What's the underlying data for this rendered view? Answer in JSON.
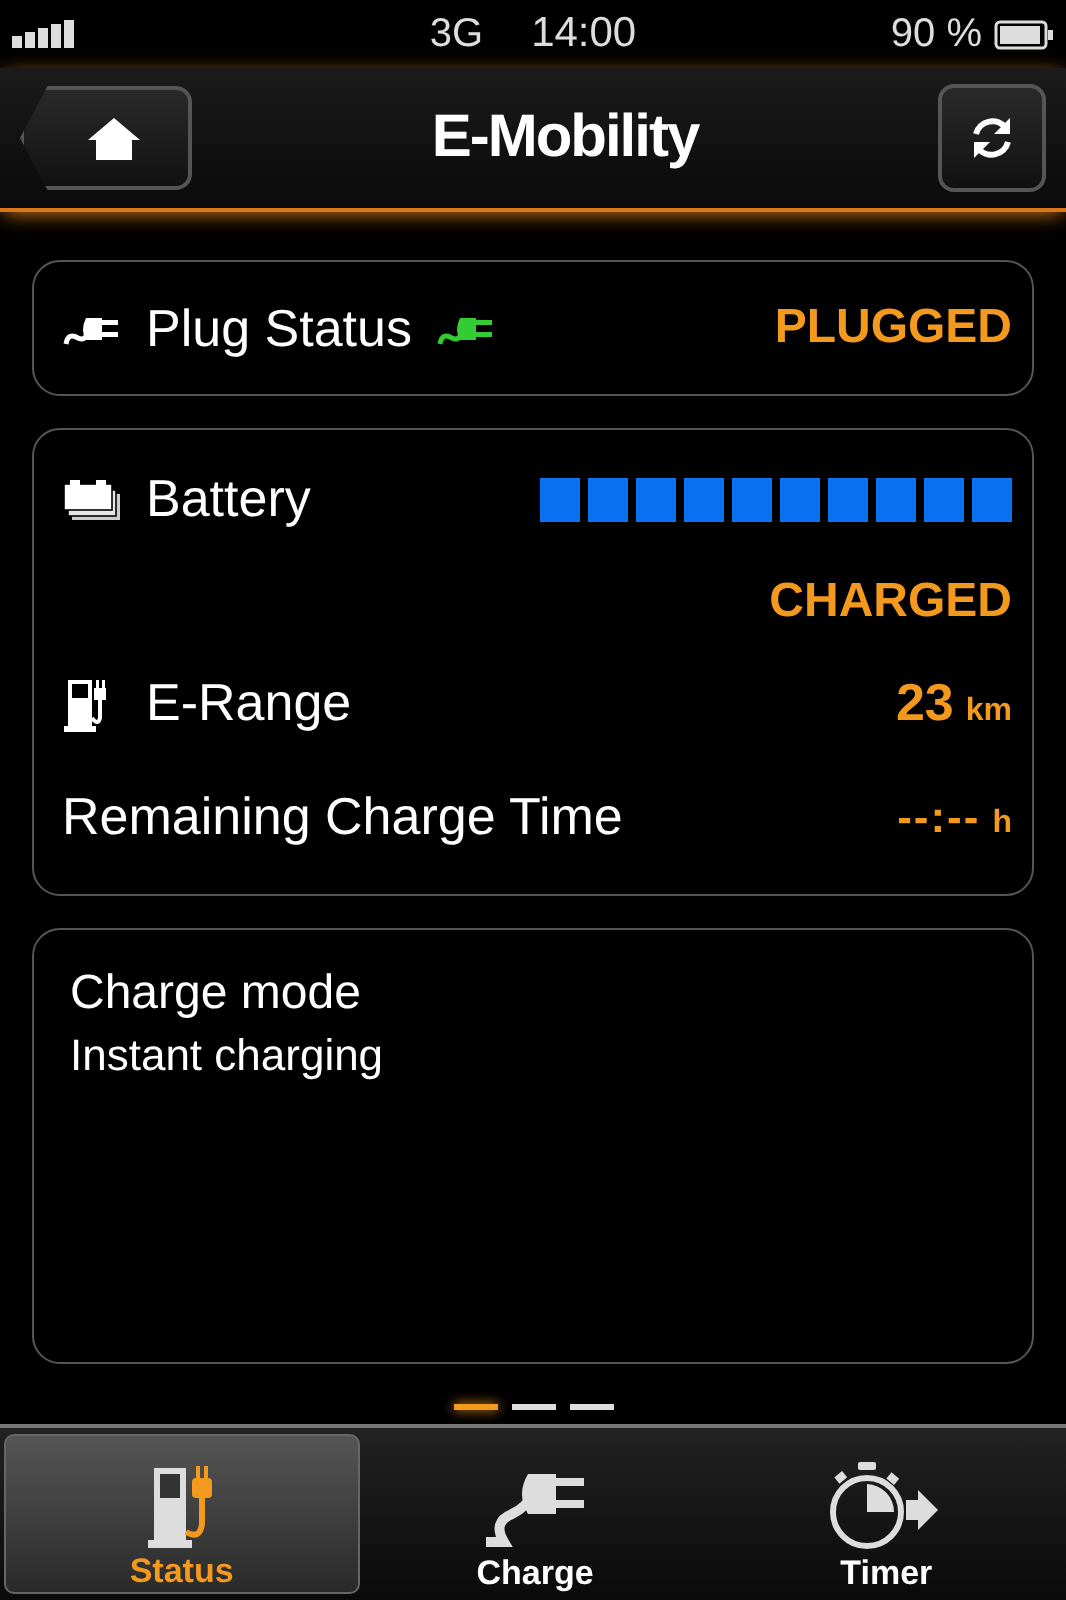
{
  "status_bar": {
    "network": "3G",
    "time": "14:00",
    "battery": "90 %"
  },
  "nav": {
    "title": "E-Mobility"
  },
  "plug": {
    "label": "Plug Status",
    "value": "PLUGGED",
    "plugged": true
  },
  "battery": {
    "label": "Battery",
    "level": 1,
    "status": "CHARGED"
  },
  "range": {
    "label": "E-Range",
    "value": "23",
    "unit": "km"
  },
  "remaining": {
    "label": "Remaining Charge Time",
    "value": "--:--",
    "unit": "h"
  },
  "charge_mode": {
    "title": "Charge mode",
    "value": "Instant charging"
  },
  "pages": [
    {
      "selected": true
    },
    {
      "selected": false
    },
    {
      "selected": false
    }
  ],
  "tabs": [
    {
      "label": "Status",
      "kind": "status",
      "selected": true
    },
    {
      "label": "Charge",
      "kind": "charge",
      "selected": false
    },
    {
      "label": "Timer",
      "kind": "timer",
      "selected": false
    }
  ]
}
